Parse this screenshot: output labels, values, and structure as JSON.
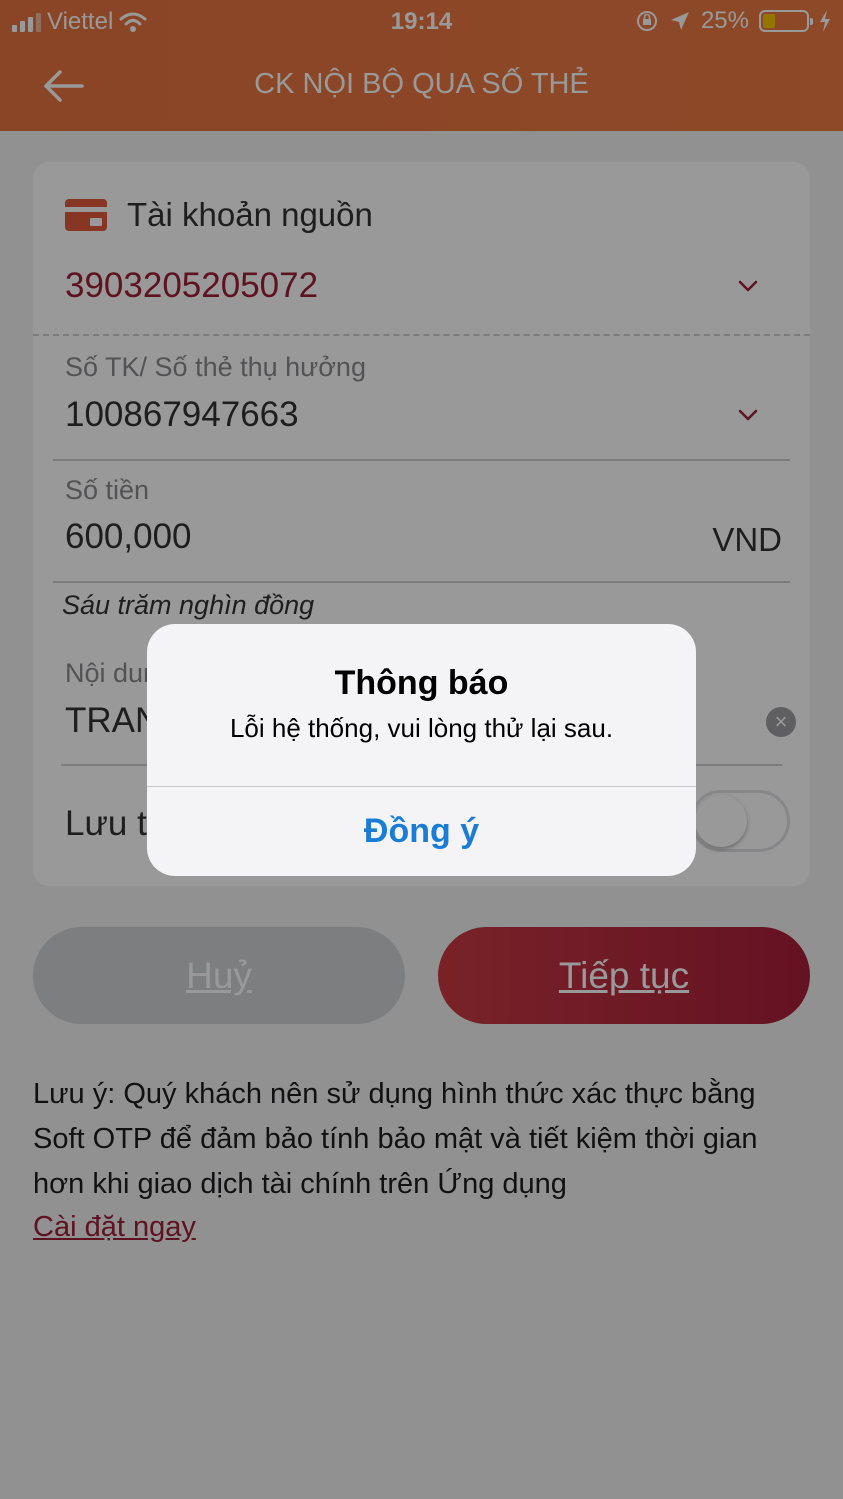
{
  "status_bar": {
    "carrier": "Viettel",
    "time": "19:14",
    "battery": "25%",
    "battery_level": 0.25,
    "icons": [
      "signal-icon",
      "wifi-icon",
      "orientation-lock-icon",
      "location-icon",
      "battery-icon",
      "charging-icon"
    ]
  },
  "header": {
    "title": "CK NỘI BỘ QUA SỐ THẺ",
    "back_icon": "arrow-left-icon"
  },
  "form": {
    "source_label": "Tài khoản nguồn",
    "source_account": "3903205205072",
    "beneficiary_label": "Số TK/ Số thẻ thụ hưởng",
    "beneficiary_value": "100867947663",
    "amount_label": "Số tiền",
    "amount_value": "600,000",
    "currency": "VND",
    "amount_in_words": "Sáu trăm nghìn đồng",
    "content_label": "Nội dun",
    "content_value": "TRAN",
    "save_label": "Lưu th",
    "save_toggle_on": false
  },
  "buttons": {
    "cancel": "Huỷ",
    "continue": "Tiếp tục"
  },
  "note": {
    "text": "Lưu ý: Quý khách nên sử dụng hình thức xác thực bằng Soft OTP để đảm bảo tính bảo mật và tiết kiệm thời gian hơn khi giao dịch tài chính trên Ứng dụng",
    "link": "Cài đặt ngay"
  },
  "alert": {
    "title": "Thông báo",
    "message": "Lỗi hệ thống, vui lòng thử lại sau.",
    "button": "Đồng ý"
  },
  "colors": {
    "header": "#ec7a44",
    "account_text": "#9d1f3a",
    "continue_button": "#b02a3e",
    "alert_button_text": "#1b7cd6"
  }
}
